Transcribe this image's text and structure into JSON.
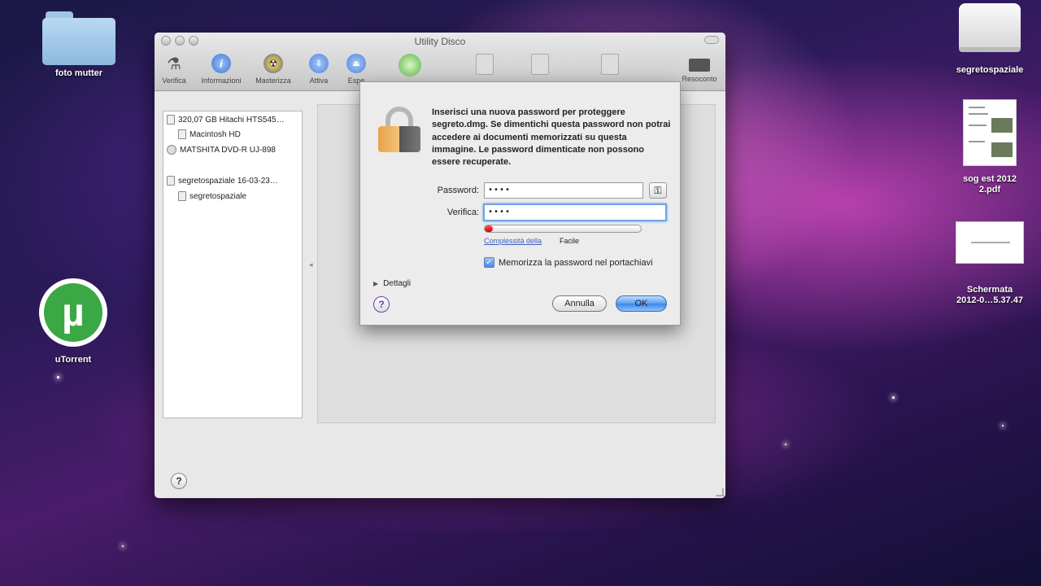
{
  "desktop": {
    "icons": [
      {
        "label": "foto mutter"
      },
      {
        "label": "segretospaziale"
      },
      {
        "label": "sog est 2012\n2.pdf"
      },
      {
        "label": "Schermata\n2012-0…5.37.47"
      },
      {
        "label": "uTorrent"
      }
    ]
  },
  "window": {
    "title": "Utility Disco",
    "toolbar": {
      "verifica": "Verifica",
      "informazioni": "Informazioni",
      "masterizza": "Masterizza",
      "attiva": "Attiva",
      "espelli": "Espe",
      "resoconto": "Resoconto"
    },
    "sidebar": {
      "items": [
        {
          "label": "320,07 GB Hitachi HTS545…"
        },
        {
          "label": "Macintosh HD"
        },
        {
          "label": "MATSHITA DVD-R UJ-898"
        },
        {
          "label": "segretospaziale 16-03-23…"
        },
        {
          "label": "segretospaziale"
        }
      ]
    }
  },
  "sheet": {
    "message": "Inserisci una nuova password per proteggere segreto.dmg. Se dimentichi questa password non potrai accedere ai documenti memorizzati su questa immagine. Le password dimenticate non possono essere recuperate.",
    "password_label": "Password:",
    "password_value": "••••",
    "verify_label": "Verifica:",
    "verify_value": "••••",
    "strength_link": "Complessità della",
    "strength_value": "Facile",
    "strength_level": 0.05,
    "remember_label": "Memorizza la password nel portachiavi",
    "remember_checked": true,
    "details_label": "Dettagli",
    "cancel_label": "Annulla",
    "ok_label": "OK"
  },
  "colors": {
    "accent": "#4c87df",
    "strength_bar": "#dd2222"
  }
}
